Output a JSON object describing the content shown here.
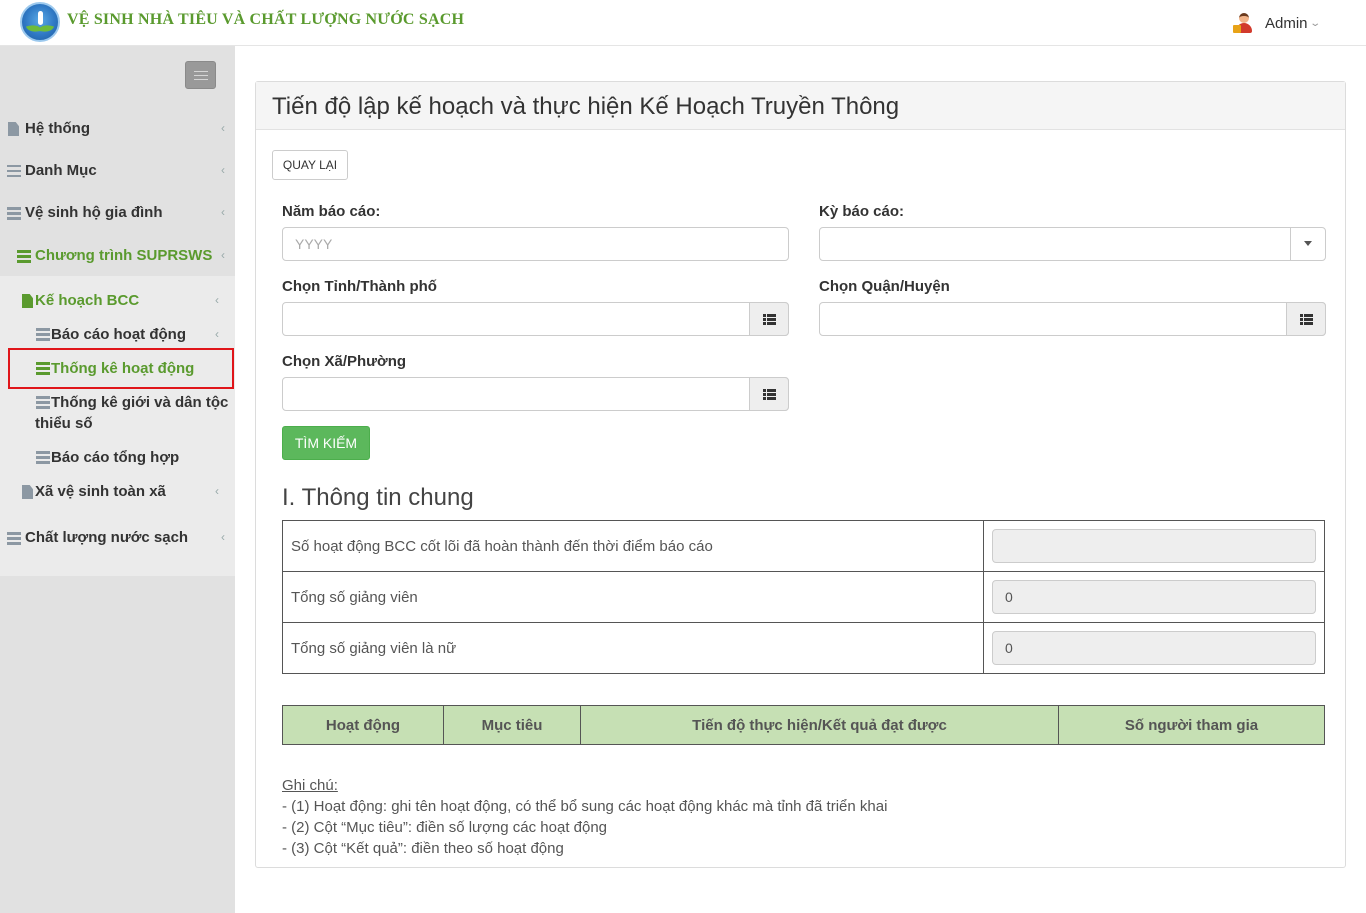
{
  "header": {
    "app_title": "VỆ SINH NHÀ TIÊU VÀ CHẤT LƯỢNG NƯỚC SẠCH",
    "user_name": "Admin"
  },
  "sidebar": {
    "items": [
      {
        "label": "Hệ thống",
        "icon": "file-icon"
      },
      {
        "label": "Danh Mục",
        "icon": "list-icon"
      },
      {
        "label": "Vệ sinh hộ gia đình",
        "icon": "stack-icon"
      },
      {
        "label": "Chương trình SUPRSWS",
        "icon": "stack-icon"
      },
      {
        "label": "Kế hoạch BCC",
        "icon": "file-icon"
      },
      {
        "label": "Báo cáo hoạt động",
        "icon": "stack-icon"
      },
      {
        "label": "Thống kê hoạt động",
        "icon": "stack-icon"
      },
      {
        "label_line1": "Thống kê giới và dân tộc",
        "label_line2": "thiểu số",
        "icon": "stack-icon"
      },
      {
        "label": "Báo cáo tổng hợp",
        "icon": "stack-icon"
      },
      {
        "label": "Xã vệ sinh toàn xã",
        "icon": "file-icon"
      },
      {
        "label": "Chất lượng nước sạch",
        "icon": "stack-icon"
      }
    ],
    "active_item": "Thống kê hoạt động"
  },
  "panel": {
    "title": "Tiến độ lập kế hoạch và thực hiện Kế Hoạch Truyền Thông",
    "back_button": "QUAY LẠI",
    "form": {
      "year_label": "Năm báo cáo:",
      "year_placeholder": "YYYY",
      "period_label": "Kỳ báo cáo:",
      "period_value": "",
      "province_label": "Chọn Tỉnh/Thành phố",
      "district_label": "Chọn Quận/Huyện",
      "commune_label": "Chọn Xã/Phường",
      "search_button": "TÌM KIẾM"
    },
    "section_title": "I. Thông tin chung",
    "info_rows": [
      {
        "question": "Số hoạt động BCC cốt lõi đã hoàn thành đến thời điểm báo cáo",
        "value": ""
      },
      {
        "question": "Tổng số giảng viên",
        "value": "0"
      },
      {
        "question": "Tổng số giảng viên là nữ",
        "value": "0"
      }
    ],
    "activity_table": {
      "columns": [
        "Hoạt động",
        "Mục tiêu",
        "Tiến độ thực hiện/Kết quả đạt được",
        "Số người tham gia"
      ]
    },
    "notes": {
      "heading": "Ghi chú:",
      "lines": [
        "- (1) Hoạt động: ghi tên hoạt động, có thể bổ sung các hoạt động khác mà tỉnh đã triển khai",
        "- (2) Cột “Mục tiêu”: điền số lượng các hoạt động",
        "- (3) Cột “Kết quả”: điền theo số hoạt động"
      ]
    }
  },
  "colors": {
    "brand_green": "#5a9a2e",
    "button_green": "#5cb85c",
    "table_header_bg": "#c6e0b4",
    "highlight_border": "#e0151a",
    "sidebar_bg": "#e1e1e1"
  }
}
